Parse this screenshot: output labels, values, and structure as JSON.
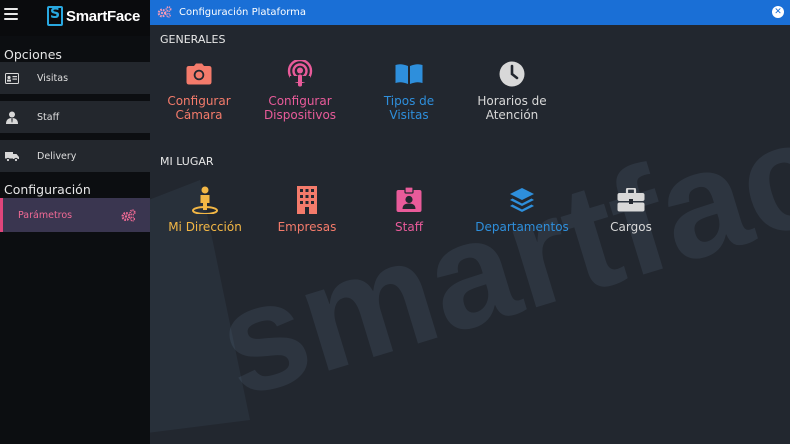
{
  "brand": {
    "name": "SmartFace",
    "accent": "#29a8e0"
  },
  "sidebar": {
    "sections": [
      {
        "title": "Opciones"
      },
      {
        "title": "Configuración"
      }
    ],
    "items": [
      {
        "label": "Visitas",
        "icon": "id-card-icon"
      },
      {
        "label": "Staff",
        "icon": "user-tie-icon"
      },
      {
        "label": "Delivery",
        "icon": "truck-icon"
      },
      {
        "label": "Parámetros",
        "icon": "gears-icon",
        "active": true
      }
    ]
  },
  "window": {
    "title": "Configuración Plataforma",
    "close": "✕"
  },
  "groups": [
    {
      "title": "GENERALES",
      "tiles": [
        {
          "label_lines": [
            "Configurar",
            "Cámara"
          ],
          "icon": "camera-icon",
          "color": "#f47b6b"
        },
        {
          "label_lines": [
            "Configurar",
            "Dispositivos"
          ],
          "icon": "podcast-icon",
          "color": "#e95b9a"
        },
        {
          "label_lines": [
            "Tipos de",
            "Visitas"
          ],
          "icon": "book-open-icon",
          "color": "#2e8fdc"
        },
        {
          "label_lines": [
            "Horarios de",
            "Atención"
          ],
          "icon": "clock-icon",
          "color": "#d8d8d8"
        }
      ]
    },
    {
      "title": "MI LUGAR",
      "tiles": [
        {
          "label_lines": [
            "Mi Dirección"
          ],
          "icon": "map-pin-person-icon",
          "color": "#f3b745"
        },
        {
          "label_lines": [
            "Empresas"
          ],
          "icon": "building-icon",
          "color": "#f47b6b"
        },
        {
          "label_lines": [
            "Staff"
          ],
          "icon": "id-badge-icon",
          "color": "#e95b9a"
        },
        {
          "label_lines": [
            "Departamentos"
          ],
          "icon": "layers-icon",
          "color": "#2e8fdc"
        },
        {
          "label_lines": [
            "Cargos"
          ],
          "icon": "briefcase-icon",
          "color": "#d8d8d8"
        }
      ]
    }
  ]
}
